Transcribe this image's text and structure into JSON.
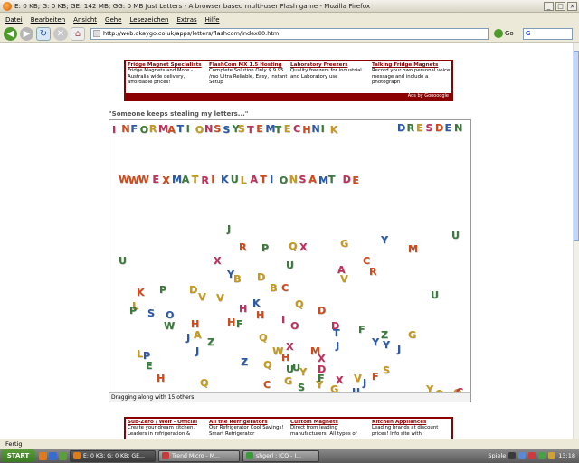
{
  "window": {
    "title": "E: 0 KB; G: 0 KB; GE: 142 MB; GG: 0 MB Just Letters - A browser based multi-user Flash game - Mozilla Firefox",
    "controls": [
      "_",
      "□",
      "×"
    ]
  },
  "menubar": {
    "items": [
      "Datei",
      "Bearbeiten",
      "Ansicht",
      "Gehe",
      "Lesezeichen",
      "Extras",
      "Hilfe"
    ]
  },
  "navbar": {
    "url": "http://web.okaygo.co.uk/apps/letters/flashcom/index80.htm",
    "go_label": "Go",
    "search_icon": "G",
    "back_glyph": "◀",
    "forward_glyph": "▶",
    "reload_glyph": "↻",
    "stop_glyph": "✕",
    "home_glyph": "⌂"
  },
  "ads_top": [
    {
      "title": "Fridge Magnet Specialists",
      "text": "Fridge Magnets and More - Australia wide delivery, affordable prices!"
    },
    {
      "title": "FlashCom MX 1.5 Hosting",
      "text": "Complete Solution Only $ 9.95 /mo Ultra Reliable, Easy, Instant Setup"
    },
    {
      "title": "Laboratory Freezers",
      "text": "Quality freezers for industrial and Laboratory use"
    },
    {
      "title": "Talking Fridge Magnets",
      "text": "Record your own personal voice message and include a photograph"
    }
  ],
  "ads_top_footer": "Ads by Gooooogle",
  "game": {
    "caption": "\"Someone keeps stealing my letters...\"",
    "status": "Dragging along with 15 others.",
    "line1": "INFORMATIONSSYSTEMTECHNIK",
    "line1b": "DRESDEN",
    "line2": "WWW EXMATRIKULATIONSAMT DE",
    "scattered": [
      [
        "J",
        "#3a7a3a"
      ],
      [
        "U",
        "#3a7a3a"
      ],
      [
        "R",
        "#d04a1a"
      ],
      [
        "P",
        "#3a7a3a"
      ],
      [
        "Q",
        "#c89a1a"
      ],
      [
        "X",
        "#c0305a"
      ],
      [
        "G",
        "#c89a1a"
      ],
      [
        "Y",
        "#2a5aa8"
      ],
      [
        "M",
        "#d04a1a"
      ],
      [
        "U",
        "#3a7a3a"
      ],
      [
        "U",
        "#3a7a3a"
      ],
      [
        "X",
        "#c0305a"
      ],
      [
        "C",
        "#d04a1a"
      ],
      [
        "Y",
        "#2a5aa8"
      ],
      [
        "A",
        "#c0305a"
      ],
      [
        "V",
        "#c89a1a"
      ],
      [
        "R",
        "#d04a1a"
      ],
      [
        "B",
        "#c89a1a"
      ],
      [
        "D",
        "#c89a1a"
      ],
      [
        "C",
        "#d04a1a"
      ],
      [
        "K",
        "#d04a1a"
      ],
      [
        "P",
        "#3a7a3a"
      ],
      [
        "D",
        "#c89a1a"
      ],
      [
        "V",
        "#c89a1a"
      ],
      [
        "V",
        "#c89a1a"
      ],
      [
        "B",
        "#c89a1a"
      ],
      [
        "K",
        "#2a5aa8"
      ],
      [
        "Q",
        "#c89a1a"
      ],
      [
        "U",
        "#3a7a3a"
      ],
      [
        "L",
        "#c89a1a"
      ],
      [
        "P",
        "#3a7a3a"
      ],
      [
        "S",
        "#2a5aa8"
      ],
      [
        "O",
        "#2a5aa8"
      ],
      [
        "D",
        "#d04a1a"
      ],
      [
        "H",
        "#d04a1a"
      ],
      [
        "I",
        "#c0305a"
      ],
      [
        "F",
        "#3a7a3a"
      ],
      [
        "O",
        "#c0305a"
      ],
      [
        "D",
        "#c0305a"
      ],
      [
        "F",
        "#3a7a3a"
      ],
      [
        "W",
        "#3a7a3a"
      ],
      [
        "A",
        "#c89a1a"
      ],
      [
        "Z",
        "#3a7a3a"
      ],
      [
        "H",
        "#d04a1a"
      ],
      [
        "Q",
        "#c89a1a"
      ],
      [
        "T",
        "#2a5aa8"
      ],
      [
        "Z",
        "#3a7a3a"
      ],
      [
        "Y",
        "#2a5aa8"
      ],
      [
        "G",
        "#c89a1a"
      ],
      [
        "J",
        "#2a5aa8"
      ],
      [
        "H",
        "#c0305a"
      ],
      [
        "J",
        "#2a5aa8"
      ],
      [
        "Y",
        "#2a5aa8"
      ],
      [
        "W",
        "#c89a1a"
      ],
      [
        "H",
        "#d04a1a"
      ],
      [
        "J",
        "#2a5aa8"
      ],
      [
        "X",
        "#c0305a"
      ],
      [
        "M",
        "#d04a1a"
      ],
      [
        "H",
        "#d04a1a"
      ],
      [
        "X",
        "#c0305a"
      ],
      [
        "L",
        "#c89a1a"
      ],
      [
        "J",
        "#2a5aa8"
      ],
      [
        "E",
        "#3a7a3a"
      ],
      [
        "Z",
        "#2a5aa8"
      ],
      [
        "Q",
        "#c89a1a"
      ],
      [
        "D",
        "#c0305a"
      ],
      [
        "U",
        "#3a7a3a"
      ],
      [
        "Y",
        "#c89a1a"
      ],
      [
        "F",
        "#3a7a3a"
      ],
      [
        "X",
        "#c0305a"
      ],
      [
        "V",
        "#c89a1a"
      ],
      [
        "F",
        "#d04a1a"
      ],
      [
        "S",
        "#c89a1a"
      ],
      [
        "H",
        "#d04a1a"
      ],
      [
        "Q",
        "#c89a1a"
      ],
      [
        "C",
        "#d04a1a"
      ],
      [
        "S",
        "#3a7a3a"
      ],
      [
        "Y",
        "#c89a1a"
      ],
      [
        "U",
        "#2a5aa8"
      ],
      [
        "G",
        "#c89a1a"
      ],
      [
        "P",
        "#2a5aa8"
      ],
      [
        "J",
        "#2a5aa8"
      ],
      [
        "Y",
        "#c89a1a"
      ],
      [
        "Q",
        "#c89a1a"
      ],
      [
        "O",
        "#c89a1a"
      ],
      [
        "G",
        "#c89a1a"
      ],
      [
        "U",
        "#3a7a3a"
      ],
      [
        "C",
        "#c0305a"
      ]
    ]
  },
  "ads_bottom": [
    {
      "title": "Sub-Zero / Wolf - Official",
      "text": "Create your dream kitchen. Leaders in refrigeration &"
    },
    {
      "title": "All the Refrigerators",
      "text": "Our Refrigerator Cool Savings! Smart Refrigerator"
    },
    {
      "title": "Custom Magnets",
      "text": "Direct from leading manufacturers! All types of"
    },
    {
      "title": "Kitchen Appliances",
      "text": "Leading brands at discount prices! Info site with"
    }
  ],
  "statusbar": {
    "text": "Fertig"
  },
  "taskbar": {
    "start_label": "START",
    "tasks": [
      {
        "label": "E: 0 KB; G: 0 KB; GE...",
        "active": true,
        "color": "#e07a1a"
      },
      {
        "label": "Trend Micro - M...",
        "active": false,
        "color": "#c83a3a"
      },
      {
        "label": "shgerl : ICQ - I...",
        "active": false,
        "color": "#3a9a3a"
      }
    ],
    "tray_label": "Spiele",
    "clock": "13:18"
  }
}
